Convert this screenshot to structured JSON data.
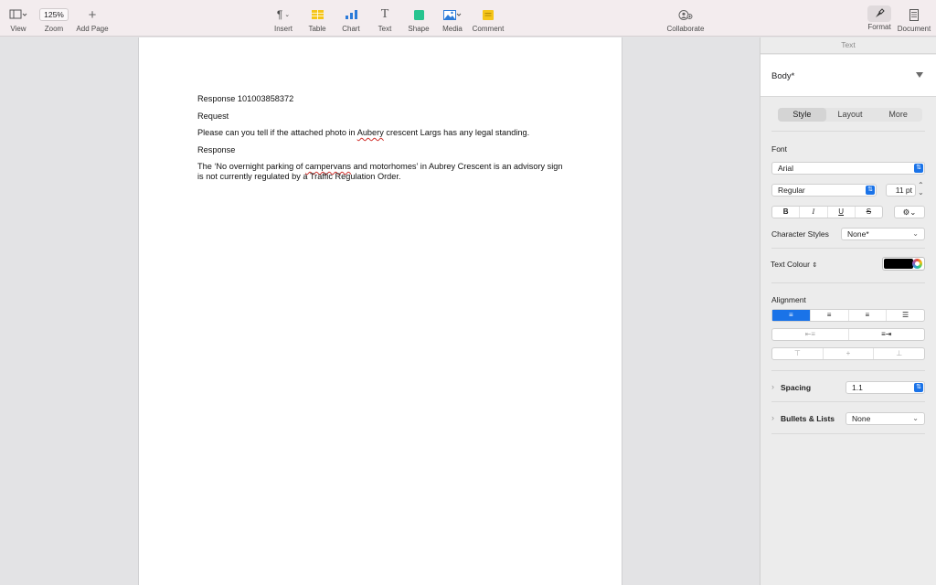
{
  "toolbar": {
    "view": {
      "label": "View",
      "icon": "sidebar-view-icon"
    },
    "zoom": {
      "label": "Zoom",
      "value": "125%"
    },
    "add_page": {
      "label": "Add Page",
      "icon": "plus-icon"
    },
    "insert": {
      "label": "Insert",
      "icon": "pilcrow-icon"
    },
    "table": {
      "label": "Table",
      "icon": "table-icon",
      "color": "#f5c518"
    },
    "chart": {
      "label": "Chart",
      "icon": "bar-chart-icon",
      "color": "#2b7bd9"
    },
    "text": {
      "label": "Text",
      "icon": "text-t-icon"
    },
    "shape": {
      "label": "Shape",
      "icon": "square-shape-icon",
      "color": "#27c48f"
    },
    "media": {
      "label": "Media",
      "icon": "photo-icon",
      "color": "#2b7bd9"
    },
    "comment": {
      "label": "Comment",
      "icon": "comment-note-icon",
      "color": "#f5c518"
    },
    "collaborate": {
      "label": "Collaborate",
      "icon": "collaborate-person-icon"
    },
    "format": {
      "label": "Format",
      "icon": "paintbrush-icon"
    },
    "document": {
      "label": "Document",
      "icon": "document-icon"
    }
  },
  "document": {
    "paragraphs": {
      "p1": "Response 101003858372",
      "p2": "Request",
      "p3_a": "Please can you tell if the attached photo in ",
      "p3_b": "Aubery",
      "p3_c": " crescent Largs has any legal standing.",
      "p4": "Response",
      "p5_a": "The ‘No overnight parking of ",
      "p5_b": "campervans",
      "p5_c": " and motorhomes’ in Aubrey Crescent is an advisory sign is not currently regulated by a Traffic Regulation Order."
    }
  },
  "sidebar": {
    "header": "Text",
    "paragraph_style": "Body*",
    "tabs": [
      "Style",
      "Layout",
      "More"
    ],
    "active_tab": "Style",
    "font_label": "Font",
    "font_family": "Arial",
    "font_typeface": "Regular",
    "font_size": "11 pt",
    "style_buttons": [
      "B",
      "I",
      "U",
      "S"
    ],
    "character_styles_label": "Character Styles",
    "character_styles_value": "None*",
    "text_colour_label": "Text Colour",
    "text_colour": "#000000",
    "alignment_label": "Alignment",
    "active_alignment": "left",
    "spacing_label": "Spacing",
    "spacing_value": "1.1",
    "bullets_label": "Bullets & Lists",
    "bullets_value": "None"
  }
}
